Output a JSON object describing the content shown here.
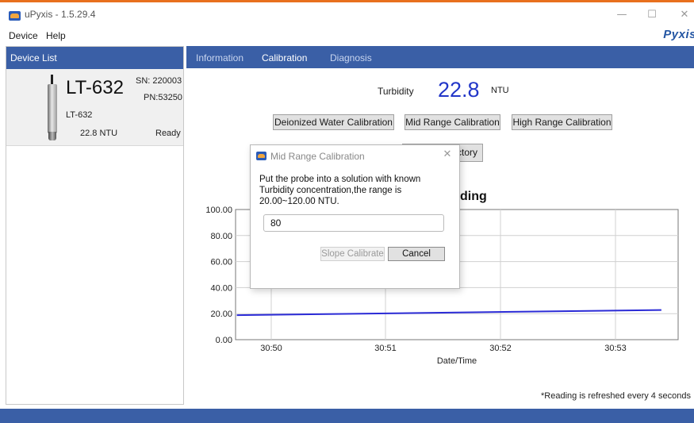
{
  "window": {
    "title": "uPyxis - 1.5.29.4",
    "minimize_glyph": "—",
    "maximize_glyph": "☐",
    "close_glyph": "✕"
  },
  "menu": {
    "device": "Device",
    "help": "Help"
  },
  "brand": "Pyxis",
  "device_list": {
    "header": "Device List",
    "devices": [
      {
        "model": "LT-632",
        "sn": "SN: 220003",
        "pn": "PN:53250",
        "model_small": "LT-632",
        "reading": "22.8  NTU",
        "status": "Ready",
        "icon": "probe-icon"
      }
    ]
  },
  "tabs": [
    {
      "label": "Information",
      "active": false
    },
    {
      "label": "Calibration",
      "active": true
    },
    {
      "label": "Diagnosis",
      "active": false
    }
  ],
  "reading": {
    "label": "Turbidity",
    "value": "22.8",
    "unit": "NTU"
  },
  "buttons": {
    "di_water": "Deionized Water Calibration",
    "mid_range": "Mid Range Calibration",
    "high_range": "High Range Calibration",
    "factory": "ctory"
  },
  "chart_title_visible": "ding",
  "chart_data": {
    "type": "line",
    "title": "",
    "xlabel": "Date/Time",
    "ylabel": "",
    "x_ticks": [
      "30:50",
      "30:51",
      "30:52",
      "30:53"
    ],
    "y_ticks": [
      "0.00",
      "20.00",
      "40.00",
      "60.00",
      "80.00",
      "100.00"
    ],
    "ylim": [
      0,
      100
    ],
    "grid": true,
    "series": [
      {
        "color": "#2b2bd6",
        "x": [
          "30:49.7",
          "30:53.4"
        ],
        "values": [
          18.8,
          22.8
        ]
      }
    ]
  },
  "refresh_note": "*Reading is refreshed every 4 seconds",
  "dialog": {
    "title": "Mid Range Calibration",
    "close_glyph": "✕",
    "message": "Put the probe into a solution with known Turbidity concentration,the range is 20.00~120.00 NTU.",
    "input_value": "80",
    "slope_button": "Slope Calibrate",
    "cancel_button": "Cancel"
  },
  "colors": {
    "accent_blue": "#3a5fa6",
    "value_blue": "#2236c8",
    "top_stripe": "#e8701e"
  }
}
